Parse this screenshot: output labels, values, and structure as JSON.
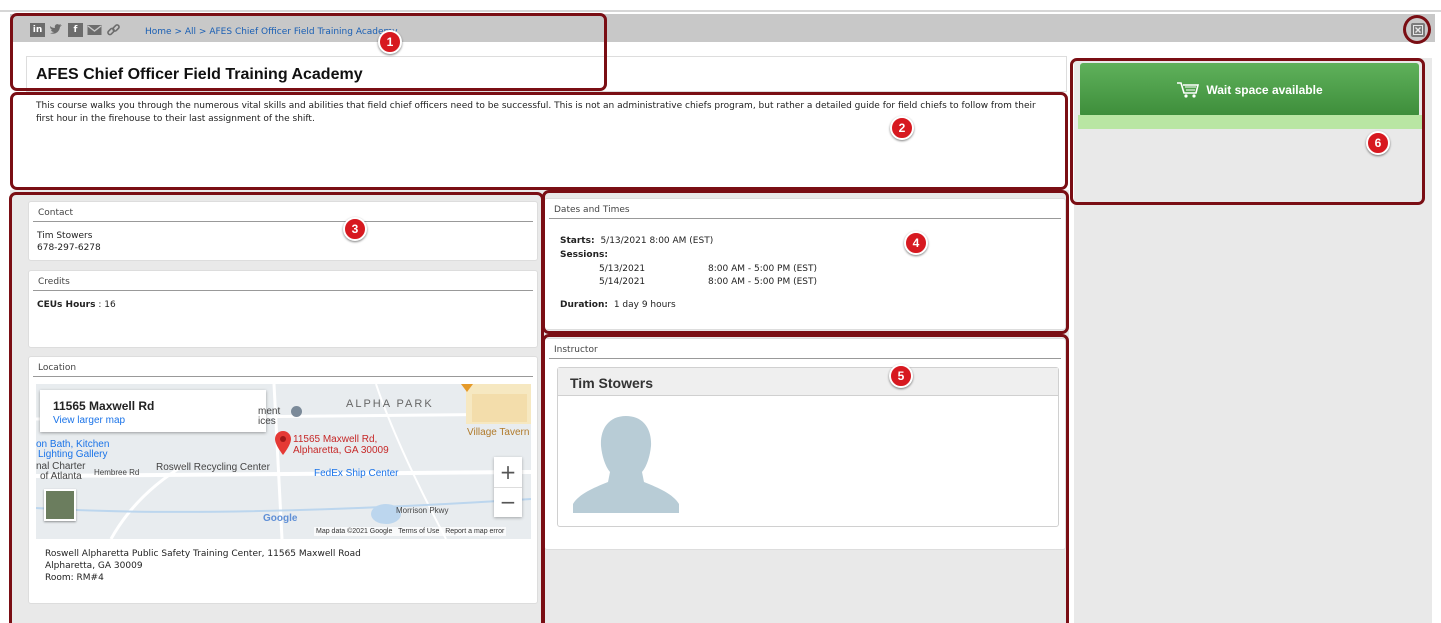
{
  "breadcrumb": {
    "home": "Home",
    "sep1": ">",
    "all": "All",
    "sep2": ">",
    "current": "AFES Chief Officer Field Training Academy"
  },
  "share_icons": [
    "linkedin-icon",
    "twitter-icon",
    "facebook-icon",
    "email-icon",
    "link-icon"
  ],
  "share_labels": {
    "linkedin": "in",
    "facebook": "f"
  },
  "course": {
    "title": "AFES Chief Officer Field Training Academy",
    "description": "This course walks you through the numerous vital skills and abilities that field chief officers need to be successful. This is not an administrative chiefs program, but rather a detailed guide for field chiefs to follow from their first hour in the firehouse to their last assignment of the shift."
  },
  "contact": {
    "heading": "Contact",
    "name": "Tim Stowers",
    "phone": "678-297-6278"
  },
  "credits": {
    "heading": "Credits",
    "label": "CEUs Hours",
    "colon": ":",
    "value": "16"
  },
  "location": {
    "heading": "Location",
    "address_line1": "Roswell Alpharetta Public Safety Training Center, 11565 Maxwell Road",
    "address_line2": "Alpharetta, GA 30009",
    "room": "Room: RM#4",
    "map": {
      "title": "11565 Maxwell Rd",
      "larger_link": "View larger map",
      "pin_label_line1": "11565 Maxwell Rd,",
      "pin_label_line2": "Alpharetta, GA 30009",
      "labels": [
        "ALPHA PARK",
        "Village Tavern",
        "on Bath, Kitchen",
        "Lighting Gallery",
        "nal Charter",
        "of Atlanta",
        "Hembree Rd",
        "Roswell Recycling Center",
        "FedEx Ship Center",
        "Morrison Pkwy",
        "Google",
        "ment",
        "ices"
      ],
      "footer": [
        "Map data ©2021 Google",
        "Terms of Use",
        "Report a map error"
      ],
      "zoom_in": "+",
      "zoom_out": "−"
    }
  },
  "dates": {
    "heading": "Dates and Times",
    "starts_label": "Starts:",
    "starts_value": "5/13/2021   8:00 AM (EST)",
    "sessions_label": "Sessions:",
    "sessions": [
      {
        "date": "5/13/2021",
        "time": "8:00 AM - 5:00 PM  (EST)"
      },
      {
        "date": "5/14/2021",
        "time": "8:00 AM - 5:00 PM  (EST)"
      }
    ],
    "duration_label": "Duration:",
    "duration_value": "1 day 9 hours"
  },
  "instructor": {
    "heading": "Instructor",
    "name": "Tim Stowers"
  },
  "actions": {
    "wait_label": "Wait space available"
  },
  "badges": [
    "1",
    "2",
    "3",
    "4",
    "5",
    "6"
  ],
  "colors": {
    "accent_red": "#d71920",
    "highlight_border": "#7a0e14",
    "button_green": "#4a9e46",
    "link_blue": "#1a5fb4"
  }
}
